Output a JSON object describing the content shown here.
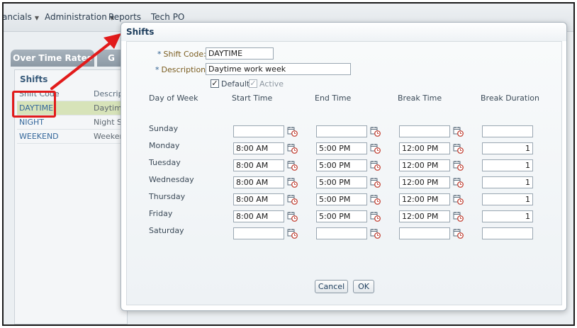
{
  "menu": {
    "items": [
      {
        "label": "ancials",
        "dropdown": true
      },
      {
        "label": "Administration",
        "dropdown": true
      },
      {
        "label": "Reports",
        "dropdown": false
      },
      {
        "label": "Tech PO",
        "dropdown": false
      }
    ]
  },
  "background": {
    "tabs": [
      {
        "label": "Over Time Rates"
      },
      {
        "label": "G"
      }
    ],
    "panel_title": "Shifts",
    "table": {
      "headers": [
        "Shift Code",
        "Descript"
      ],
      "rows": [
        {
          "code": "DAYTIME",
          "desc": "Daytime"
        },
        {
          "code": "NIGHT",
          "desc": "Night Sh"
        },
        {
          "code": "WEEKEND",
          "desc": "Weeken"
        }
      ]
    }
  },
  "dialog": {
    "title": "Shifts",
    "shift_code_label": "Shift Code:",
    "shift_code_value": "DAYTIME",
    "description_label": "Description:",
    "description_value": "Daytime work week",
    "default_label": "Default",
    "default_checked": "✓",
    "active_label": "Active",
    "active_checked": "✓",
    "columns": [
      "Day of Week",
      "Start Time",
      "End Time",
      "Break Time",
      "Break Duration"
    ],
    "days": [
      {
        "day": "Sunday",
        "start": "",
        "end": "",
        "break": "",
        "duration": ""
      },
      {
        "day": "Monday",
        "start": "8:00 AM",
        "end": "5:00 PM",
        "break": "12:00 PM",
        "duration": "1"
      },
      {
        "day": "Tuesday",
        "start": "8:00 AM",
        "end": "5:00 PM",
        "break": "12:00 PM",
        "duration": "1"
      },
      {
        "day": "Wednesday",
        "start": "8:00 AM",
        "end": "5:00 PM",
        "break": "12:00 PM",
        "duration": "1"
      },
      {
        "day": "Thursday",
        "start": "8:00 AM",
        "end": "5:00 PM",
        "break": "12:00 PM",
        "duration": "1"
      },
      {
        "day": "Friday",
        "start": "8:00 AM",
        "end": "5:00 PM",
        "break": "12:00 PM",
        "duration": "1"
      },
      {
        "day": "Saturday",
        "start": "",
        "end": "",
        "break": "",
        "duration": ""
      }
    ],
    "cancel_label": "Cancel",
    "ok_label": "OK"
  },
  "colors": {
    "highlight": "#e21b1b",
    "selected_row": "#d7e3b9",
    "title_text": "#1d3d5c",
    "link_text": "#34679b"
  },
  "icons": {
    "time_picker": "calendar-clock-icon",
    "menu_caret": "chevron-down-icon"
  }
}
